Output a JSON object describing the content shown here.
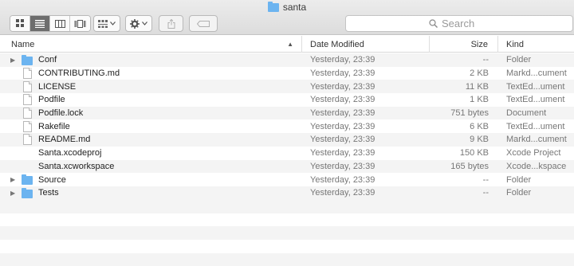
{
  "window": {
    "title": "santa"
  },
  "toolbar": {
    "view_icons": [
      "grid-view-icon",
      "list-view-icon",
      "column-view-icon",
      "gallery-view-icon"
    ],
    "active_view": "list"
  },
  "search": {
    "placeholder": "Search"
  },
  "columns": {
    "name": "Name",
    "date": "Date Modified",
    "size": "Size",
    "kind": "Kind"
  },
  "files": [
    {
      "name": "Conf",
      "date": "Yesterday, 23:39",
      "size": "--",
      "kind": "Folder",
      "type": "folder"
    },
    {
      "name": "CONTRIBUTING.md",
      "date": "Yesterday, 23:39",
      "size": "2 KB",
      "kind": "Markd...cument",
      "type": "doc"
    },
    {
      "name": "LICENSE",
      "date": "Yesterday, 23:39",
      "size": "11 KB",
      "kind": "TextEd...ument",
      "type": "doc"
    },
    {
      "name": "Podfile",
      "date": "Yesterday, 23:39",
      "size": "1 KB",
      "kind": "TextEd...ument",
      "type": "doc"
    },
    {
      "name": "Podfile.lock",
      "date": "Yesterday, 23:39",
      "size": "751 bytes",
      "kind": "Document",
      "type": "doc"
    },
    {
      "name": "Rakefile",
      "date": "Yesterday, 23:39",
      "size": "6 KB",
      "kind": "TextEd...ument",
      "type": "doc"
    },
    {
      "name": "README.md",
      "date": "Yesterday, 23:39",
      "size": "9 KB",
      "kind": "Markd...cument",
      "type": "doc"
    },
    {
      "name": "Santa.xcodeproj",
      "date": "Yesterday, 23:39",
      "size": "150 KB",
      "kind": "Xcode Project",
      "type": "xcode"
    },
    {
      "name": "Santa.xcworkspace",
      "date": "Yesterday, 23:39",
      "size": "165 bytes",
      "kind": "Xcode...kspace",
      "type": "xcode"
    },
    {
      "name": "Source",
      "date": "Yesterday, 23:39",
      "size": "--",
      "kind": "Folder",
      "type": "folder"
    },
    {
      "name": "Tests",
      "date": "Yesterday, 23:39",
      "size": "--",
      "kind": "Folder",
      "type": "folder"
    }
  ]
}
